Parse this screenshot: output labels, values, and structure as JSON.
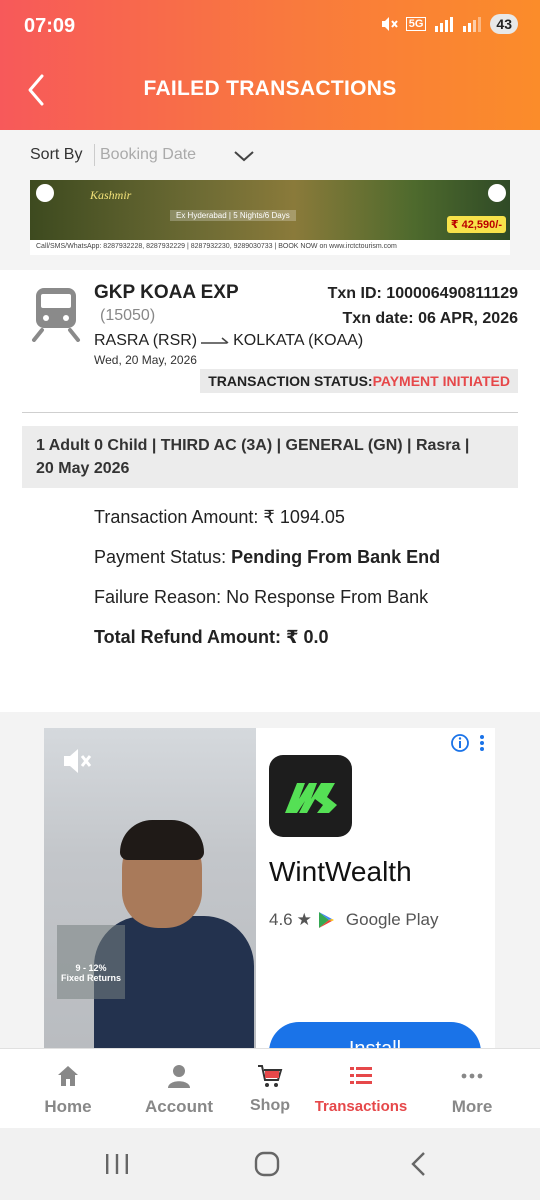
{
  "status_bar": {
    "time": "07:09",
    "network": "5G",
    "battery": "43"
  },
  "header": {
    "title": "FAILED TRANSACTIONS"
  },
  "sort": {
    "label": "Sort By",
    "value": "Booking Date"
  },
  "banner": {
    "brand": "Kashmir",
    "subtitle": "Ex Hyderabad | 5 Nights/6 Days",
    "price": "₹ 42,590/-",
    "footer": "Call/SMS/WhatsApp: 8287932228, 8287932229 | 8287932230, 9289030733 | BOOK NOW on www.irctctourism.com"
  },
  "transaction": {
    "train_name": "GKP KOAA EXP",
    "train_number": "(15050)",
    "txn_id": "Txn ID: 100006490811129",
    "txn_date": "Txn date: 06 APR, 2026",
    "from": "RASRA (RSR)",
    "to": "KOLKATA (KOAA)",
    "journey_date": "Wed, 20 May, 2026",
    "status_label": "TRANSACTION STATUS:",
    "status_value": "PAYMENT INITIATED",
    "passenger_line_1": "1 Adult 0 Child  | THIRD AC (3A) | GENERAL (GN) | Rasra |",
    "passenger_line_2": "20 May 2026",
    "amount_label": "Transaction Amount: ",
    "amount_value": "₹  1094.05",
    "payment_status_label": "Payment Status: ",
    "payment_status_value": "Pending From Bank End",
    "failure_label": "Failure Reason: ",
    "failure_value": "No Response From Bank",
    "refund_label": "Total Refund Amount: ",
    "refund_value": "₹ 0.0"
  },
  "ad": {
    "returns_line_1": "9 - 12%",
    "returns_line_2": "Fixed Returns",
    "app_name": "WintWealth",
    "rating": "4.6",
    "store": "Google Play",
    "install_label": "Install"
  },
  "bottom_nav": {
    "items": [
      {
        "label": "Home",
        "icon": "home-icon"
      },
      {
        "label": "Account",
        "icon": "account-icon"
      },
      {
        "label": "Shop",
        "icon": "cart-icon"
      },
      {
        "label": "Transactions",
        "icon": "list-icon"
      },
      {
        "label": "More",
        "icon": "more-dots-icon"
      }
    ],
    "active": "Transactions"
  },
  "colors": {
    "header_gradient_start": "#f7595a",
    "header_gradient_end": "#fb8c2a",
    "status_red": "#e6484a",
    "install_blue": "#1a73e8"
  }
}
